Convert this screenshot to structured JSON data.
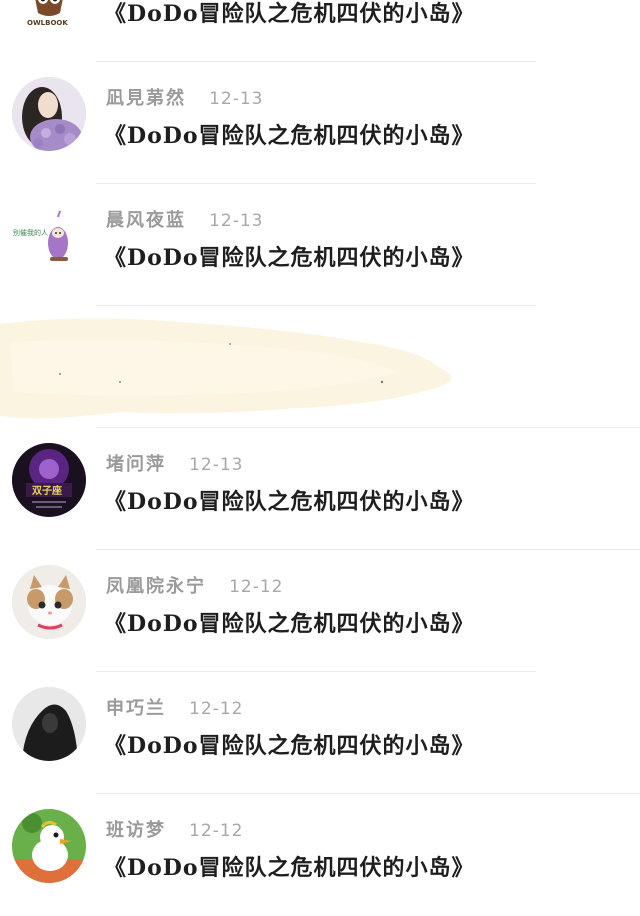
{
  "comments": [
    {
      "avatar": "owlbook-logo-avatar",
      "logo_text": "OWLBOOK",
      "name": "",
      "date": "",
      "text": "《DoDo冒险队之危机四伏的小岛》"
    },
    {
      "avatar": "woman-with-flowers-avatar",
      "name": "凪見苐然",
      "date": "12-13",
      "text": "《DoDo冒险队之危机四伏的小岛》"
    },
    {
      "avatar": "purple-cartoon-avatar",
      "avatar_text": "别催我的人",
      "name": "晨风夜蓝",
      "date": "12-13",
      "text": "《DoDo冒险队之危机四伏的小岛》"
    },
    {
      "avatar": "",
      "name": "",
      "date": "",
      "text": ""
    },
    {
      "avatar": "purple-logo-avatar",
      "avatar_text": "双子座",
      "name": "堵问萍",
      "date": "12-13",
      "text": "《DoDo冒险队之危机四伏的小岛》"
    },
    {
      "avatar": "kitten-avatar",
      "name": "凤凰院永宁",
      "date": "12-12",
      "text": "《DoDo冒险队之危机四伏的小岛》"
    },
    {
      "avatar": "hooded-person-avatar",
      "name": "申巧兰",
      "date": "12-12",
      "text": "《DoDo冒险队之危机四伏的小岛》"
    },
    {
      "avatar": "cartoon-duck-avatar",
      "name": "班访梦",
      "date": "12-12",
      "text": "《DoDo冒险队之危机四伏的小岛》"
    }
  ]
}
